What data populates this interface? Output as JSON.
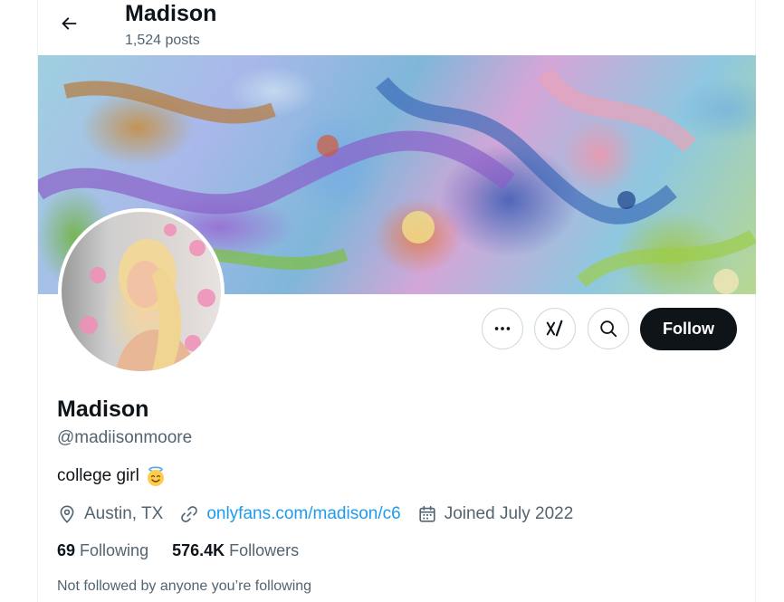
{
  "header": {
    "name": "Madison",
    "posts": "1,524 posts"
  },
  "profile": {
    "display_name": "Madison",
    "handle": "@madiisonmoore",
    "bio": "college girl",
    "bio_emoji": "smiling-face-with-halo",
    "location": "Austin, TX",
    "website": "onlyfans.com/madison/c6",
    "joined": "Joined July 2022"
  },
  "actions": {
    "more_icon": "more-icon",
    "grok_icon": "grok-icon",
    "search_icon": "search-icon",
    "follow_label": "Follow"
  },
  "stats": {
    "following_count": "69",
    "following_label": "Following",
    "followers_count": "576.4K",
    "followers_label": "Followers"
  },
  "social_context": "Not followed by anyone you’re following",
  "colors": {
    "text_primary": "#0f1419",
    "text_secondary": "#536471",
    "link": "#1d9bf0",
    "follow_button_bg": "#0f1419",
    "border": "#cfd9de"
  }
}
